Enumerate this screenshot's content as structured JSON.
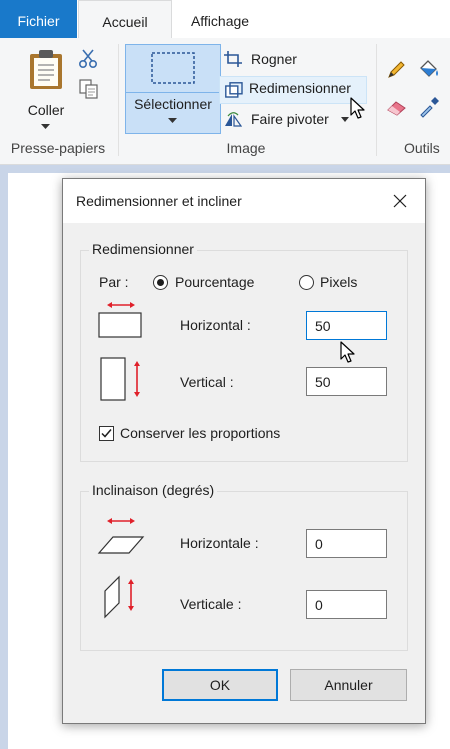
{
  "tabs": {
    "file": "Fichier",
    "home": "Accueil",
    "view": "Affichage"
  },
  "ribbon": {
    "clipboard": {
      "paste": "Coller",
      "group_label": "Presse-papiers"
    },
    "image": {
      "select": "Sélectionner",
      "crop": "Rogner",
      "resize": "Redimensionner",
      "rotate": "Faire pivoter",
      "group_label": "Image"
    },
    "tools": {
      "group_label": "Outils"
    }
  },
  "dialog": {
    "title": "Redimensionner et incliner",
    "resize": {
      "legend": "Redimensionner",
      "by_label": "Par :",
      "percent_label": "Pourcentage",
      "pixels_label": "Pixels",
      "selected_unit": "percent",
      "horizontal_label": "Horizontal :",
      "horizontal_value": "50",
      "vertical_label": "Vertical :",
      "vertical_value": "50",
      "keep_ratio_label": "Conserver les proportions",
      "keep_ratio_checked": true
    },
    "skew": {
      "legend": "Inclinaison (degrés)",
      "horizontal_label": "Horizontale :",
      "horizontal_value": "0",
      "vertical_label": "Verticale :",
      "vertical_value": "0"
    },
    "ok": "OK",
    "cancel": "Annuler"
  },
  "colors": {
    "accent": "#1979ca",
    "focus": "#0078d7",
    "arrow": "#e0202a",
    "selected_bg": "#c9e0f7"
  }
}
